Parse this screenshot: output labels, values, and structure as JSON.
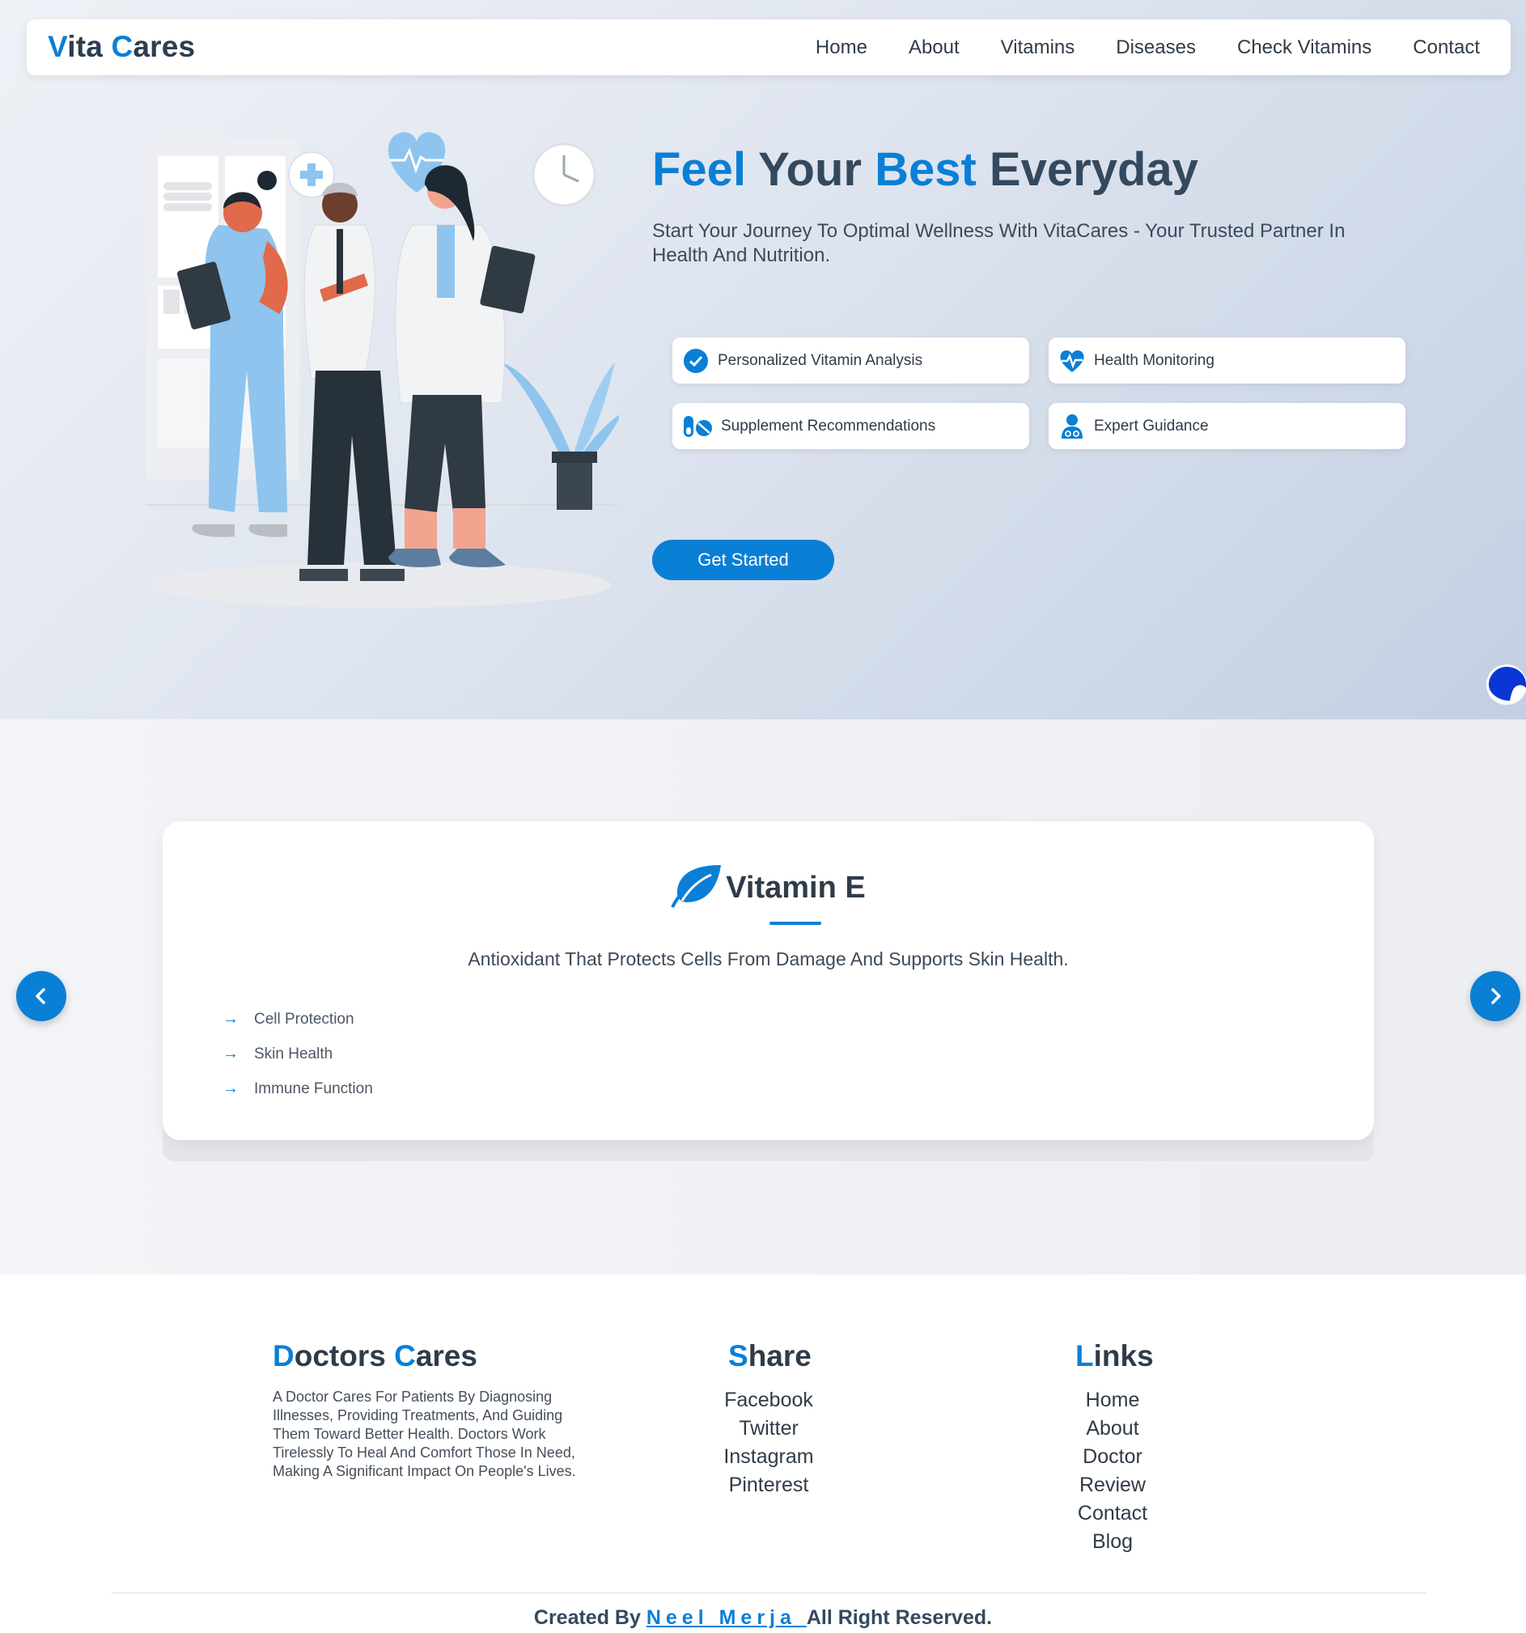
{
  "nav": {
    "logo_v": "V",
    "logo_rest": "ita ",
    "logo_c": "C",
    "logo_rest2": "ares",
    "links": [
      "Home",
      "About",
      "Vitamins",
      "Diseases",
      "Check Vitamins",
      "Contact"
    ]
  },
  "hero": {
    "headline": {
      "w1": "Feel",
      "w2": "Your",
      "w3": "Best",
      "w4": "Everyday"
    },
    "subtitle": "Start Your Journey To Optimal Wellness With VitaCares - Your Trusted Partner In Health And Nutrition.",
    "features": [
      {
        "label": "Personalized Vitamin Analysis",
        "icon": "check-circle-icon"
      },
      {
        "label": "Health Monitoring",
        "icon": "heartbeat-icon"
      },
      {
        "label": "Supplement Recommendations",
        "icon": "pills-icon"
      },
      {
        "label": "Expert Guidance",
        "icon": "doctor-icon"
      }
    ],
    "cta_label": "Get Started"
  },
  "slider": {
    "title": "Vitamin E",
    "icon": "leaf-icon",
    "description": "Antioxidant That Protects Cells From Damage And Supports Skin Health.",
    "benefits": [
      "Cell Protection",
      "Skin Health",
      "Immune Function"
    ],
    "arrow_glyph": "→"
  },
  "footer": {
    "about": {
      "title_a1": "D",
      "title_a2": "octors ",
      "title_a3": "C",
      "title_a4": "ares",
      "text": "A Doctor Cares For Patients By Diagnosing Illnesses, Providing Treatments, And Guiding Them Toward Better Health. Doctors Work Tirelessly To Heal And Comfort Those In Need, Making A Significant Impact On People's Lives."
    },
    "share": {
      "title_a": "S",
      "title_b": "hare",
      "items": [
        "Facebook",
        "Twitter",
        "Instagram",
        "Pinterest"
      ]
    },
    "links": {
      "title_a": "L",
      "title_b": "inks",
      "items": [
        "Home",
        "About",
        "Doctor",
        "Review",
        "Contact",
        "Blog"
      ]
    },
    "credit_prefix": "Created By ",
    "credit_name": "Neel Merja ",
    "credit_suffix": "All Right Reserved."
  },
  "colors": {
    "accent": "#0a7fd6",
    "dark": "#2c3e50"
  }
}
